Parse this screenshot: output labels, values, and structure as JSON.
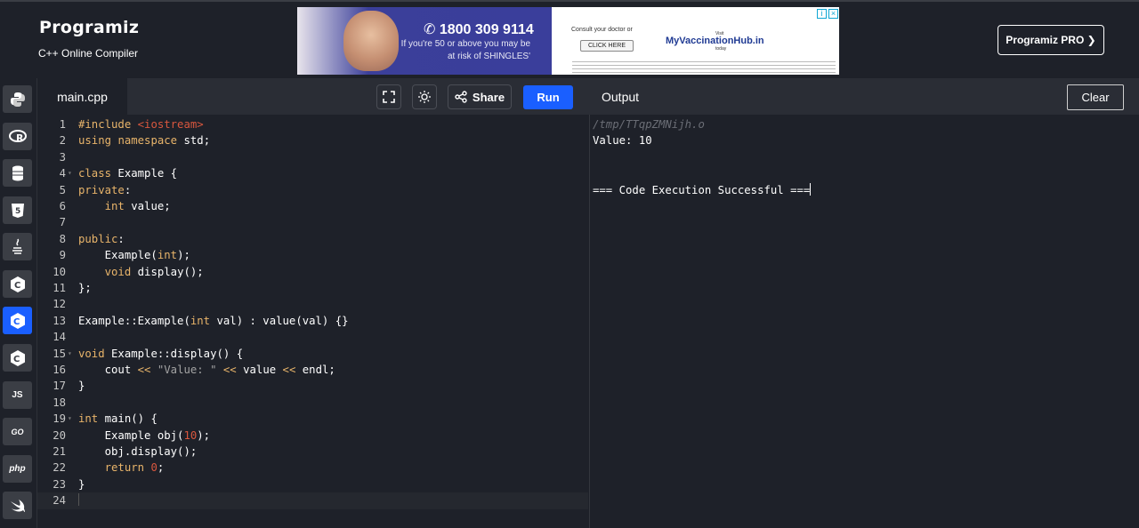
{
  "header": {
    "logo_text": "Programiz",
    "subtitle": "C++ Online Compiler",
    "pro_button": "Programiz PRO ❯"
  },
  "ad": {
    "phone": "1800 309 9114",
    "text": "If you're 50 or above you may be at risk of SHINGLES'",
    "consult": "Consult your doctor or",
    "click": "CLICK HERE",
    "visit": "Visit",
    "hub_prefix": "My",
    "hub_main": "VaccinationHub.in",
    "today": "today"
  },
  "sidebar": {
    "items": [
      {
        "name": "python",
        "label": ""
      },
      {
        "name": "r",
        "label": ""
      },
      {
        "name": "sql",
        "label": ""
      },
      {
        "name": "html",
        "label": ""
      },
      {
        "name": "java",
        "label": ""
      },
      {
        "name": "c",
        "label": ""
      },
      {
        "name": "cpp",
        "label": "",
        "active": true
      },
      {
        "name": "csharp",
        "label": ""
      },
      {
        "name": "js",
        "label": "JS"
      },
      {
        "name": "go",
        "label": "GO"
      },
      {
        "name": "php",
        "label": "php"
      },
      {
        "name": "swift",
        "label": ""
      }
    ]
  },
  "editor": {
    "tab": "main.cpp",
    "share_label": "Share",
    "run_label": "Run",
    "lines": [
      "#include <iostream>",
      "using namespace std;",
      "",
      "class Example {",
      "private:",
      "    int value;",
      "",
      "public:",
      "    Example(int);",
      "    void display();",
      "};",
      "",
      "Example::Example(int val) : value(val) {}",
      "",
      "void Example::display() {",
      "    cout << \"Value: \" << value << endl;",
      "}",
      "",
      "int main() {",
      "    Example obj(10);",
      "    obj.display();",
      "    return 0;",
      "}",
      ""
    ],
    "line_numbers": [
      "1",
      "2",
      "3",
      "4",
      "5",
      "6",
      "7",
      "8",
      "9",
      "10",
      "11",
      "12",
      "13",
      "14",
      "15",
      "16",
      "17",
      "18",
      "19",
      "20",
      "21",
      "22",
      "23",
      "24"
    ]
  },
  "output": {
    "title": "Output",
    "clear_label": "Clear",
    "path": "/tmp/TTqpZMNijh.o",
    "value_line": "Value: 10",
    "success_line": "=== Code Execution Successful ==="
  }
}
